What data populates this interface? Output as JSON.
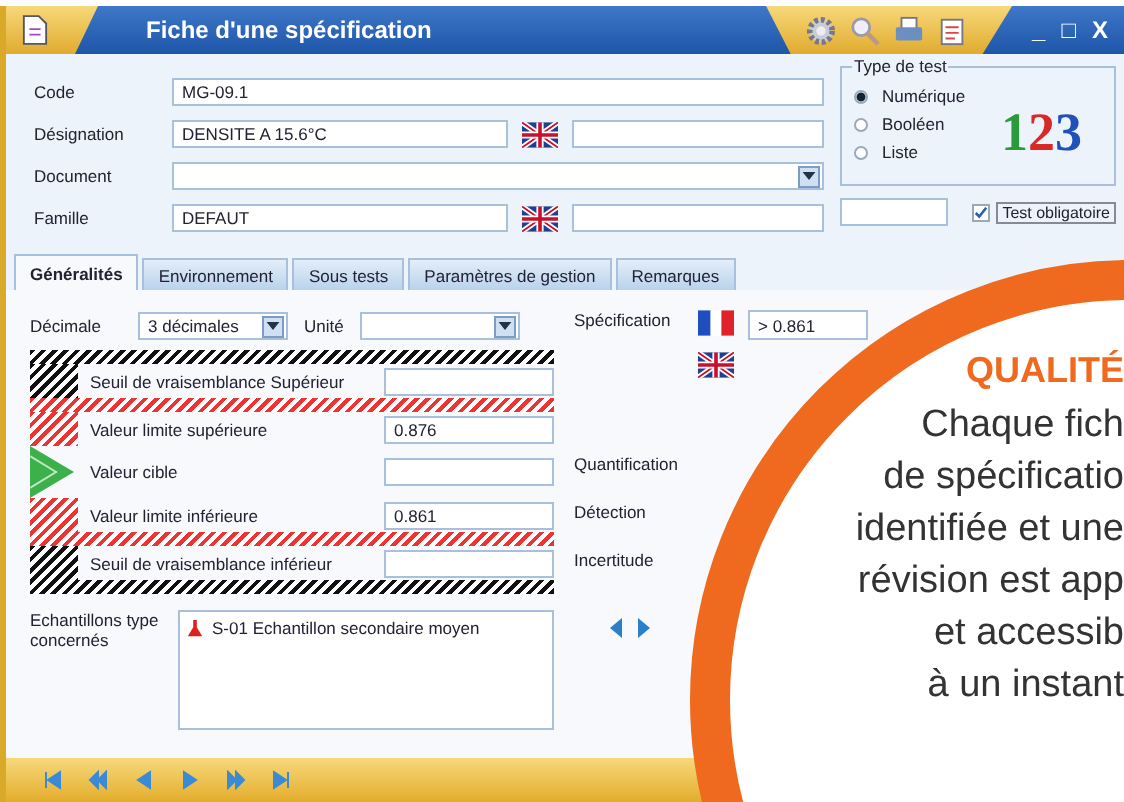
{
  "window": {
    "title": "Fiche d'une spécification",
    "controls": [
      "_",
      "□",
      "X"
    ]
  },
  "form": {
    "code": {
      "label": "Code",
      "value": "MG-09.1"
    },
    "designation": {
      "label": "Désignation",
      "value": "DENSITE A 15.6°C"
    },
    "document": {
      "label": "Document"
    },
    "famille": {
      "label": "Famille",
      "value": "DEFAUT"
    }
  },
  "test_type": {
    "legend": "Type de test",
    "logo": "123",
    "options": [
      {
        "label": "Numérique",
        "selected": true
      },
      {
        "label": "Booléen",
        "selected": false
      },
      {
        "label": "Liste",
        "selected": false
      }
    ]
  },
  "mandatory": {
    "label": "Test obligatoire",
    "checked": true
  },
  "tabs": [
    {
      "label": "Généralités",
      "selected": true
    },
    {
      "label": "Environnement",
      "selected": false
    },
    {
      "label": "Sous tests",
      "selected": false
    },
    {
      "label": "Paramètres de gestion",
      "selected": false
    },
    {
      "label": "Remarques",
      "selected": false
    }
  ],
  "general": {
    "decimale": {
      "label": "Décimale",
      "value": "3 décimales"
    },
    "unite": {
      "label": "Unité"
    },
    "limits": [
      {
        "kind": "outer_band"
      },
      {
        "kind": "outer_field",
        "label": "Seuil de vraisemblance Supérieur"
      },
      {
        "kind": "inner_band"
      },
      {
        "kind": "inner_field",
        "label": "Valeur limite supérieure",
        "value": "0.876"
      },
      {
        "kind": "target_field",
        "label": "Valeur cible"
      },
      {
        "kind": "inner_field",
        "label": "Valeur limite inférieure",
        "value": "0.861"
      },
      {
        "kind": "inner_band"
      },
      {
        "kind": "outer_field",
        "label": "Seuil de vraisemblance inférieur"
      },
      {
        "kind": "outer_band"
      }
    ],
    "samples": {
      "label": "Echantillons type concernés",
      "items": [
        "S-01 Echantillon secondaire moyen"
      ]
    },
    "specification": {
      "label": "Spécification",
      "value": "> 0.861"
    },
    "right_labels": [
      "Quantification",
      "Détection",
      "Incertitude"
    ]
  },
  "callout": {
    "title": "QUALITÉ",
    "lines": [
      "Chaque fich",
      "de spécificatio",
      "identifiée et une",
      "révision est app",
      "et accessib",
      "à un instant"
    ]
  }
}
